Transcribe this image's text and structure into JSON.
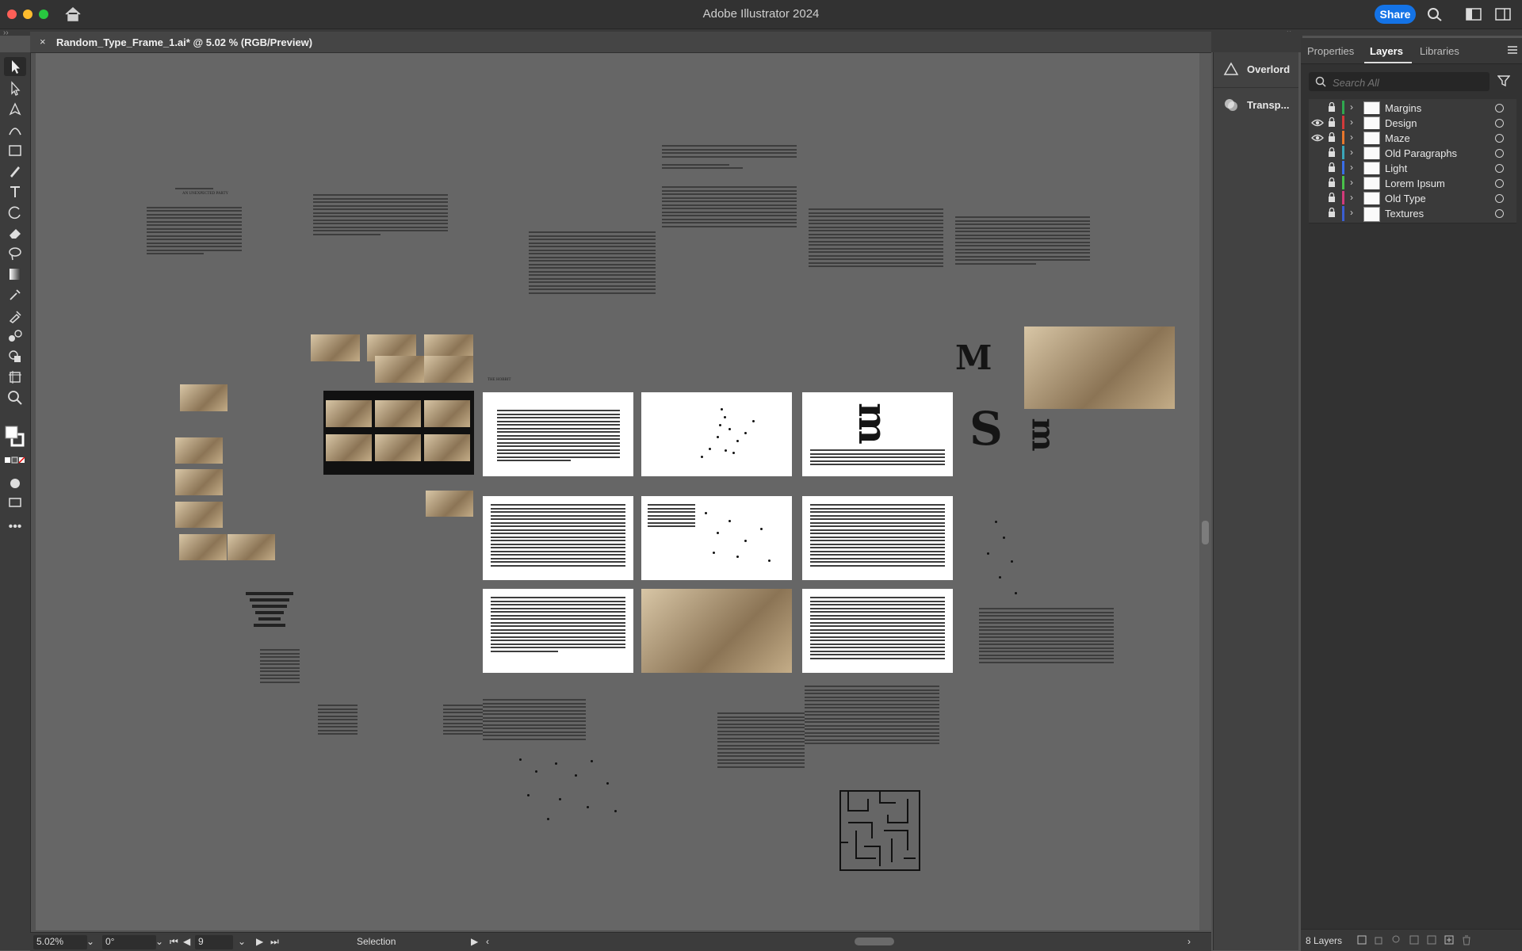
{
  "window": {
    "app_title": "Adobe Illustrator 2024",
    "share_label": "Share"
  },
  "document": {
    "tab_title": "Random_Type_Frame_1.ai* @ 5.02 % (RGB/Preview)",
    "close_symbol": "×"
  },
  "statusbar": {
    "zoom": "5.02%",
    "rotation": "0°",
    "artboard_index": "9",
    "tool_label": "Selection"
  },
  "mid_panel": {
    "items": [
      {
        "label": "Overlord",
        "icon": "triangle-icon"
      },
      {
        "label": "Transp...",
        "icon": "transparency-icon"
      }
    ]
  },
  "layers_panel": {
    "tabs": [
      "Properties",
      "Layers",
      "Libraries"
    ],
    "active_tab": "Layers",
    "search_placeholder": "Search All",
    "layer_count": "8 Layers",
    "layers": [
      {
        "name": "Margins",
        "visible": false,
        "color": "#2fa84f"
      },
      {
        "name": "Design",
        "visible": true,
        "color": "#d23a3a"
      },
      {
        "name": "Maze",
        "visible": true,
        "color": "#e8762c"
      },
      {
        "name": "Old Paragraphs",
        "visible": false,
        "color": "#3aa6b9"
      },
      {
        "name": "Light",
        "visible": false,
        "color": "#3a6ee8"
      },
      {
        "name": "Lorem Ipsum",
        "visible": false,
        "color": "#49c24a"
      },
      {
        "name": "Old Type",
        "visible": false,
        "color": "#d23a7a"
      },
      {
        "name": "Textures",
        "visible": false,
        "color": "#3a5ed2"
      }
    ]
  },
  "canvas_text": {
    "chapter_heading": "AN UNEXPECTED PARTY",
    "big_m": "M",
    "big_s": "S",
    "big_m_rot": "m",
    "hobbit_label": "THE HOBBIT"
  }
}
